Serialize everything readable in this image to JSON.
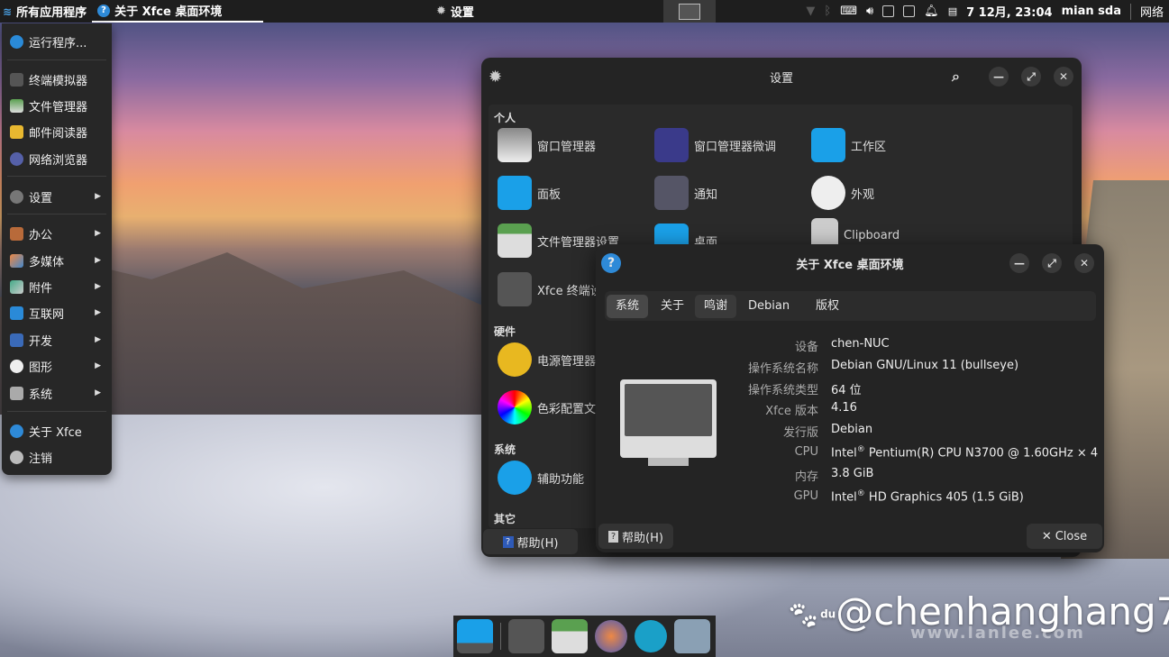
{
  "panel": {
    "apps_label": "所有应用程序",
    "active_window": "关于 Xfce 桌面环境",
    "center_window": "设置",
    "datetime": "7 12月, 23:04",
    "user": "mian sda",
    "network": "网络"
  },
  "menu": {
    "run": "运行程序...",
    "terminal": "终端模拟器",
    "filemgr": "文件管理器",
    "mail": "邮件阅读器",
    "browser": "网络浏览器",
    "settings": "设置",
    "office": "办公",
    "multimedia": "多媒体",
    "accessories": "附件",
    "internet": "互联网",
    "dev": "开发",
    "graphics": "图形",
    "system": "系统",
    "about": "关于 Xfce",
    "logout": "注销"
  },
  "settings": {
    "title": "设置",
    "cat_personal": "个人",
    "cat_hardware": "硬件",
    "cat_system": "系统",
    "cat_other": "其它",
    "items": [
      "窗口管理器",
      "窗口管理器微调",
      "工作区",
      "面板",
      "通知",
      "外观",
      "文件管理器设置",
      "桌面",
      "Clipboard",
      "Xfce 终端设置",
      "电源管理器",
      "色彩配置文件",
      "辅助功能"
    ],
    "help": "帮助(H)"
  },
  "about": {
    "title": "关于 Xfce 桌面环境",
    "tabs": [
      "系统",
      "关于",
      "鸣谢",
      "Debian",
      "版权"
    ],
    "labels": [
      "设备",
      "操作系统名称",
      "操作系统类型",
      "Xfce 版本",
      "发行版",
      "CPU",
      "内存",
      "GPU"
    ],
    "values": {
      "device": "chen-NUC",
      "os": "Debian GNU/Linux 11 (bullseye)",
      "ostype": "64 位",
      "xfce": "4.16",
      "distro": "Debian",
      "cpu_pre": "Intel",
      "cpu_post": " Pentium(R) CPU N3700 @ 1.60GHz × 4",
      "mem": "3.8 GiB",
      "gpu_pre": "Intel",
      "gpu_post": " HD Graphics 405 (1.5 GiB)"
    },
    "reg": "®",
    "help": "帮助(H)",
    "close": "Close"
  },
  "watermark": {
    "handle": "@chenhanghang7",
    "site": "www.lanlee.com",
    "logo_text": "du"
  }
}
